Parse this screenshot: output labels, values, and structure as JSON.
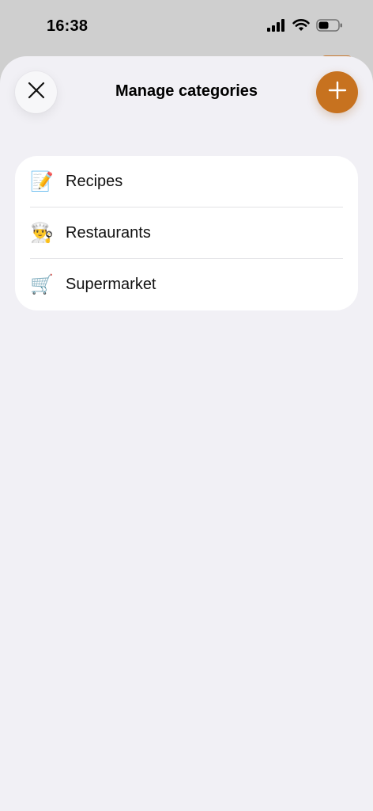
{
  "status": {
    "time": "16:38",
    "icons": [
      "signal-icon",
      "wifi-icon",
      "battery-icon"
    ]
  },
  "header": {
    "title": "Manage categories",
    "close_icon": "close-icon",
    "add_icon": "plus-icon"
  },
  "categories": [
    {
      "label": "Recipes",
      "icon": "memo-pencil-icon",
      "emoji": "📝"
    },
    {
      "label": "Restaurants",
      "icon": "chef-icon",
      "emoji": "👨‍🍳"
    },
    {
      "label": "Supermarket",
      "icon": "shopping-cart-icon",
      "emoji": "🛒"
    }
  ],
  "colors": {
    "accent": "#c7721f",
    "sheet_bg": "#f1f0f5",
    "card_bg": "#ffffff",
    "text": "#111111"
  }
}
